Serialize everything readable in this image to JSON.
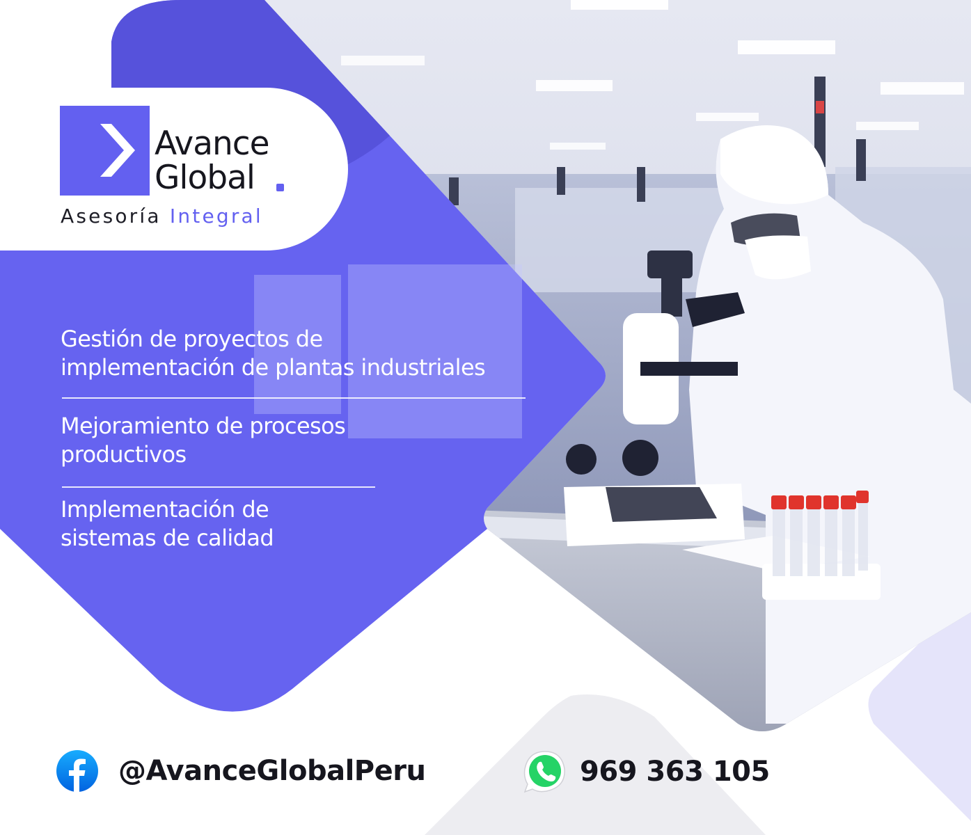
{
  "brand": {
    "name_line1": "Avance",
    "name_line2": "Global",
    "tagline_part1": "Asesoría",
    "tagline_part2": "Integral"
  },
  "services": [
    {
      "line1": "Gestión de proyectos de",
      "line2": "implementación de plantas industriales"
    },
    {
      "line1": "Mejoramiento de procesos",
      "line2": "productivos"
    },
    {
      "line1": "Implementación de",
      "line2": "sistemas de calidad"
    }
  ],
  "contact": {
    "facebook_handle": "@AvanceGlobalPeru",
    "whatsapp_number": "969 363 105",
    "facebook_icon": "facebook-icon",
    "whatsapp_icon": "whatsapp-icon"
  },
  "colors": {
    "brand_purple": "#6360f0",
    "dark_text": "#16161e",
    "facebook_blue": "#1877f2",
    "whatsapp_green": "#25d366"
  }
}
